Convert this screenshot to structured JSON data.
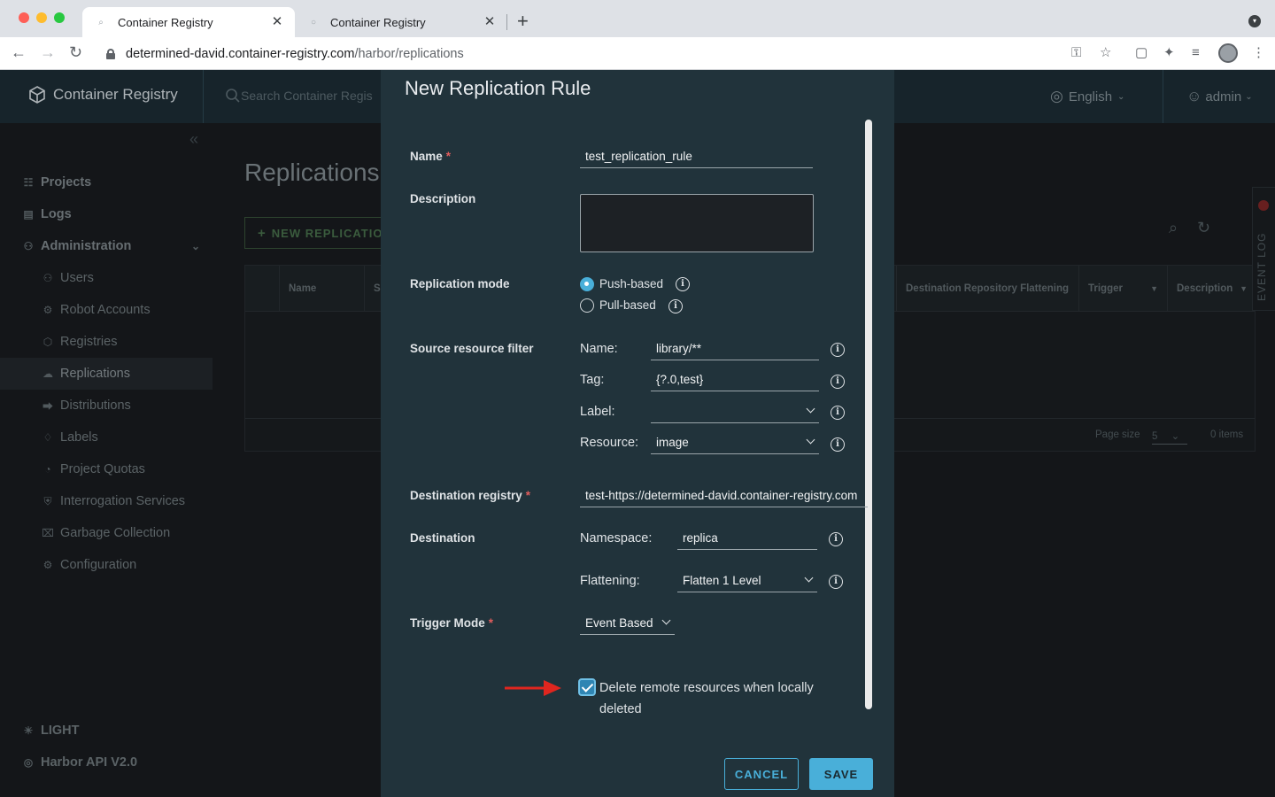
{
  "browser": {
    "tabs": [
      {
        "title": "Container Registry",
        "active": true
      },
      {
        "title": "Container Registry",
        "active": false
      }
    ],
    "url_host": "determined-david.container-registry.com",
    "url_path": "/harbor/replications"
  },
  "app": {
    "brand": "Container Registry",
    "search_placeholder": "Search Container Regis",
    "language": "English",
    "user": "admin"
  },
  "sidebar": {
    "items": [
      {
        "label": "Projects",
        "icon": "projects-icon"
      },
      {
        "label": "Logs",
        "icon": "logs-icon"
      },
      {
        "label": "Administration",
        "icon": "administration-icon"
      },
      {
        "label": "Users",
        "icon": "users-icon"
      },
      {
        "label": "Robot Accounts",
        "icon": "robot-icon"
      },
      {
        "label": "Registries",
        "icon": "registries-icon"
      },
      {
        "label": "Replications",
        "icon": "replications-icon"
      },
      {
        "label": "Distributions",
        "icon": "distributions-icon"
      },
      {
        "label": "Labels",
        "icon": "labels-icon"
      },
      {
        "label": "Project Quotas",
        "icon": "quotas-icon"
      },
      {
        "label": "Interrogation Services",
        "icon": "shield-icon"
      },
      {
        "label": "Garbage Collection",
        "icon": "trash-icon"
      },
      {
        "label": "Configuration",
        "icon": "gear-icon"
      }
    ],
    "theme_toggle": "LIGHT",
    "api_link": "Harbor API V2.0"
  },
  "page": {
    "title": "Replications",
    "new_button": "NEW REPLICATIO",
    "columns": [
      "Name",
      "S",
      "Destination Repository Flattening",
      "Trigger",
      "Description"
    ],
    "page_size_label": "Page size",
    "page_size_value": "5",
    "items_count": "0 items",
    "event_log": "EVENT LOG"
  },
  "modal": {
    "title": "New Replication Rule",
    "name_label": "Name",
    "name_value": "test_replication_rule",
    "description_label": "Description",
    "description_value": "",
    "replication_mode_label": "Replication mode",
    "push_based": "Push-based",
    "pull_based": "Pull-based",
    "selected_mode": "Push-based",
    "source_filter_label": "Source resource filter",
    "filter_name_label": "Name:",
    "filter_name_value": "library/**",
    "filter_tag_label": "Tag:",
    "filter_tag_value": "{?.0,test}",
    "filter_label_label": "Label:",
    "filter_label_value": "",
    "filter_resource_label": "Resource:",
    "filter_resource_value": "image",
    "dest_registry_label": "Destination registry",
    "dest_registry_value": "test-https://determined-david.container-registry.com",
    "destination_label": "Destination",
    "namespace_label": "Namespace:",
    "namespace_value": "replica",
    "flattening_label": "Flattening:",
    "flattening_value": "Flatten 1 Level",
    "trigger_label": "Trigger Mode",
    "trigger_value": "Event Based",
    "delete_remote_label": "Delete remote resources when locally deleted",
    "delete_remote_checked": true,
    "cancel": "CANCEL",
    "save": "SAVE"
  },
  "colors": {
    "accent": "#49afd9",
    "required": "#e05d5d",
    "annotation_arrow": "#e0261f"
  }
}
